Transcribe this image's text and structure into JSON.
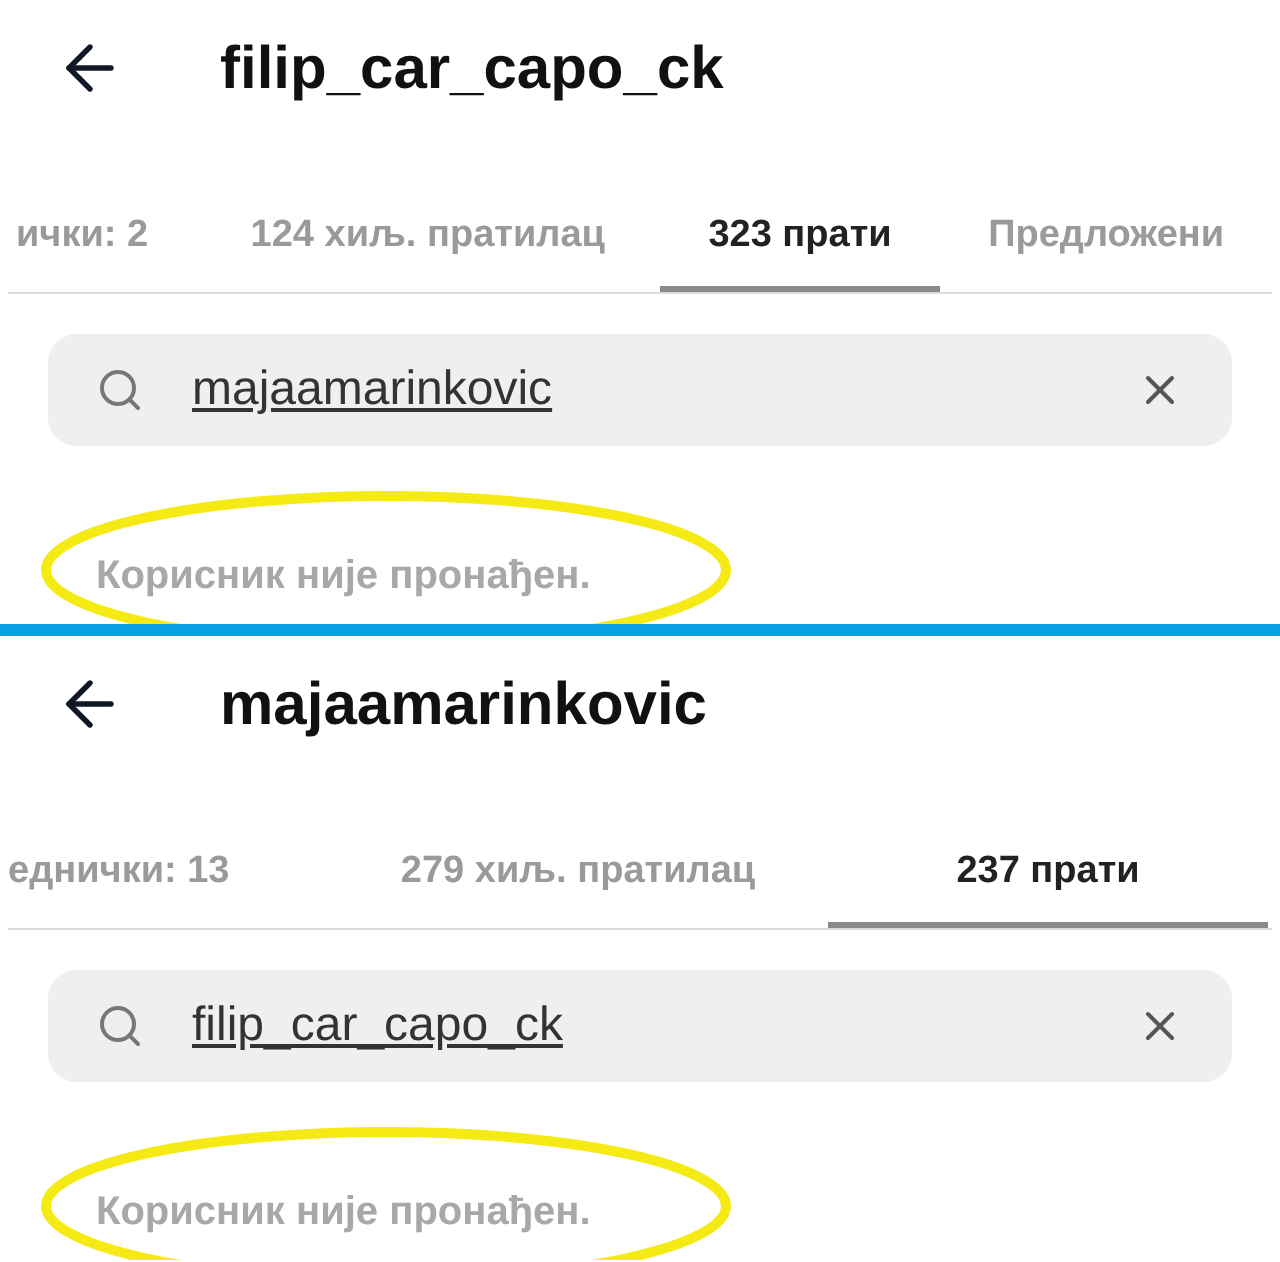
{
  "panels": [
    {
      "title": "filip_car_capo_ck",
      "tabs": [
        {
          "label": "ички: 2",
          "selected": false
        },
        {
          "label": "124 хиљ. пратилац",
          "selected": false
        },
        {
          "label": "323 прати",
          "selected": true
        },
        {
          "label": "Предложени",
          "selected": false
        }
      ],
      "search": {
        "value": "majaamarinkovic"
      },
      "message": {
        "text": "Корисник није пронађен.",
        "circled": true
      }
    },
    {
      "title": "majaamarinkovic",
      "tabs": [
        {
          "label": "еднички: 13",
          "selected": false
        },
        {
          "label": "279 хиљ. пратилац",
          "selected": false
        },
        {
          "label": "237 прати",
          "selected": true
        }
      ],
      "search": {
        "value": "filip_car_capo_ck"
      },
      "message": {
        "text": "Корисник није пронађен.",
        "circled": true
      }
    }
  ]
}
